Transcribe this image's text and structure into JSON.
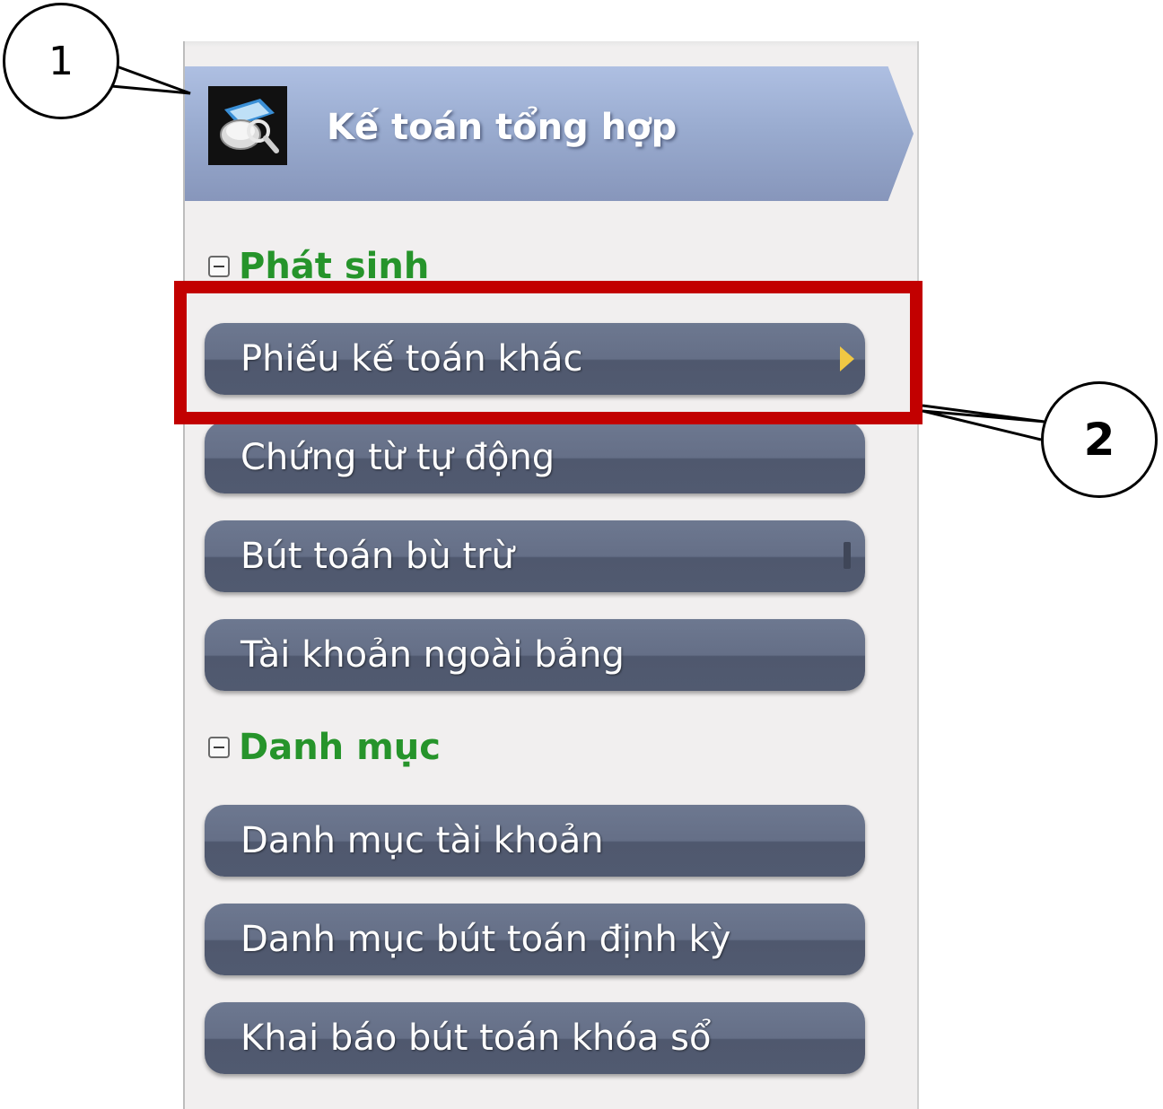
{
  "header": {
    "title": "Kế toán tổng hợp",
    "icon": "accounting-magnifier-icon"
  },
  "sections": [
    {
      "title": "Phát sinh",
      "items": [
        {
          "label": "Phiếu kế toán khác"
        },
        {
          "label": "Chứng từ tự động"
        },
        {
          "label": "Bút toán bù trừ"
        },
        {
          "label": "Tài khoản ngoài bảng"
        }
      ]
    },
    {
      "title": "Danh mục",
      "items": [
        {
          "label": "Danh mục tài khoản"
        },
        {
          "label": "Danh mục bút toán định kỳ"
        },
        {
          "label": "Khai báo bút toán khóa sổ"
        }
      ]
    }
  ],
  "callouts": {
    "first": "1",
    "second": "2"
  },
  "colors": {
    "section_title": "#26942b",
    "highlight": "#c20000",
    "menu_button": "#5f6980",
    "header": "#9aacd0"
  }
}
